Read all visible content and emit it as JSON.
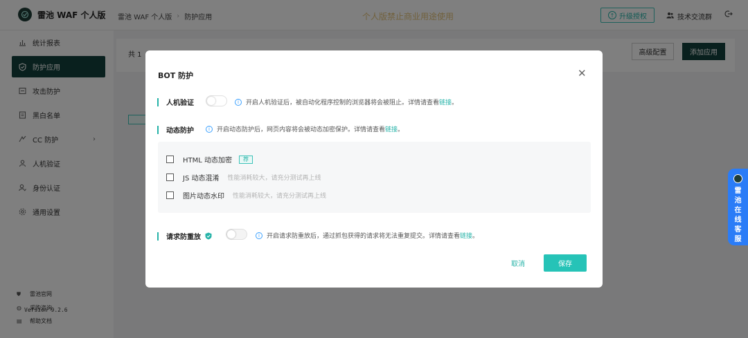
{
  "header": {
    "brand": "雷池 WAF 个人版",
    "breadcrumb": [
      "雷池 WAF 个人版",
      "防护应用"
    ],
    "notice": "个人版禁止商业用途使用",
    "upgrade_label": "升级授权",
    "group_label": "技术交流群"
  },
  "sidebar": {
    "items": [
      {
        "label": "统计报表",
        "icon": "chart-icon"
      },
      {
        "label": "防护应用",
        "icon": "shield-icon"
      },
      {
        "label": "攻击防护",
        "icon": "attack-icon"
      },
      {
        "label": "黑白名单",
        "icon": "list-icon"
      },
      {
        "label": "CC 防护",
        "icon": "cc-icon"
      },
      {
        "label": "人机验证",
        "icon": "human-icon"
      },
      {
        "label": "身份认证",
        "icon": "identity-icon"
      },
      {
        "label": "通用设置",
        "icon": "gear-icon"
      }
    ],
    "version": "Version 9.2.6",
    "footer_links": [
      {
        "label": "雷池官网",
        "icon": "home-icon"
      },
      {
        "label": "采购咨询",
        "icon": "chat-icon"
      },
      {
        "label": "帮助文档",
        "icon": "doc-icon"
      }
    ]
  },
  "main": {
    "total_text": "共 1",
    "adv_config_label": "高级配置",
    "add_app_label": "添加应用"
  },
  "modal": {
    "title": "BOT 防护",
    "captcha": {
      "label": "人机验证",
      "hint": "开启人机验证后，被自动化程序控制的浏览器将会被阻止。详情请查看",
      "link": "链接",
      "suffix": "。"
    },
    "dynamic": {
      "label": "动态防护",
      "hint": "开启动态防护后，网页内容将会被动态加密保护。详情请查看",
      "link": "链接",
      "suffix": "。",
      "options": [
        {
          "label": "HTML 动态加密",
          "tag": "荐",
          "note": ""
        },
        {
          "label": "JS 动态混淆",
          "note": "性能消耗较大，请充分测试再上线"
        },
        {
          "label": "图片动态水印",
          "note": "性能消耗较大，请充分测试再上线"
        }
      ]
    },
    "replay": {
      "label": "请求防重放",
      "hint": "开启请求防重放后，通过抓包获得的请求将无法重复提交。详情请查看",
      "link": "链接",
      "suffix": "。"
    },
    "cancel_label": "取消",
    "save_label": "保存"
  },
  "float_service": {
    "label": "雷池在线客服"
  },
  "colors": {
    "accent": "#26b3a8",
    "sidebar_active": "#13413c",
    "float_blue": "#2a7cf7",
    "notice": "#e3c27a"
  }
}
